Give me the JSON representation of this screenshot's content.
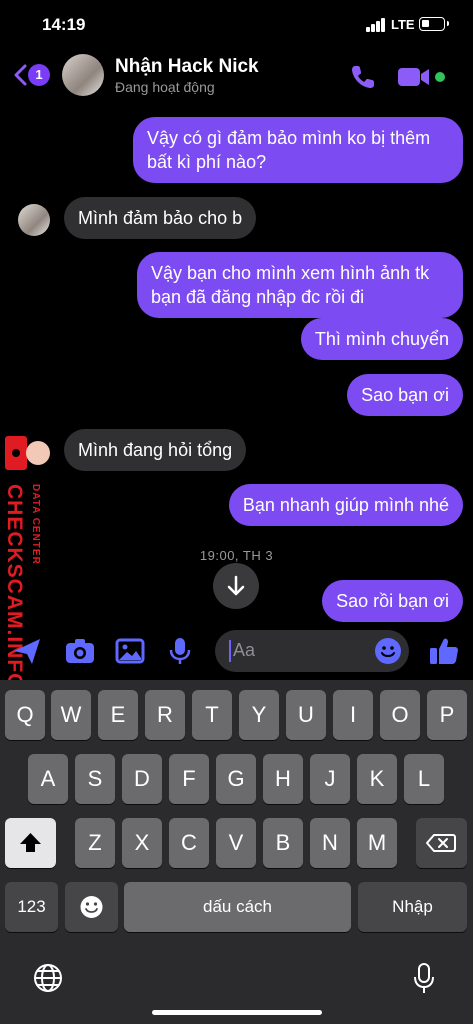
{
  "status_bar": {
    "time": "14:19",
    "network": "LTE",
    "battery_fraction": 0.35
  },
  "header": {
    "back_badge": "1",
    "contact_name": "Nhận Hack Nick",
    "contact_status": "Đang hoạt động"
  },
  "messages": [
    {
      "side": "out",
      "lines": [
        "Vậy có gì đảm bảo mình ko bị thêm",
        "bất kì phí nào?"
      ]
    },
    {
      "side": "in",
      "text": "Mình đảm bảo cho b"
    },
    {
      "side": "out",
      "lines": [
        "Vậy bạn cho mình xem hình ảnh tk",
        "bạn đã đăng nhập đc rồi đi"
      ]
    },
    {
      "side": "out",
      "text": "Thì mình chuyển"
    },
    {
      "side": "out",
      "text": "Sao bạn ơi"
    },
    {
      "side": "in",
      "text": "Mình đang hỏi tổng"
    },
    {
      "side": "out",
      "text": "Bạn nhanh giúp mình nhé"
    },
    {
      "side": "out",
      "text": "Sao rồi bạn ơi"
    }
  ],
  "time_separator": "19:00, TH 3",
  "watermark": {
    "main": "CHECKSCAM.INFO",
    "sub": "DATA CENTER"
  },
  "composer": {
    "placeholder": "Aa"
  },
  "keyboard": {
    "row1": [
      "Q",
      "W",
      "E",
      "R",
      "T",
      "Y",
      "U",
      "I",
      "O",
      "P"
    ],
    "row2": [
      "A",
      "S",
      "D",
      "F",
      "G",
      "H",
      "J",
      "K",
      "L"
    ],
    "row3": [
      "Z",
      "X",
      "C",
      "V",
      "B",
      "N",
      "M"
    ],
    "numbers_key": "123",
    "space_key": "dấu cách",
    "return_key": "Nhập"
  },
  "colors": {
    "accent": "#7d4bf2",
    "incoming": "#303033",
    "online": "#32c45a",
    "watermark": "#e01b22"
  }
}
